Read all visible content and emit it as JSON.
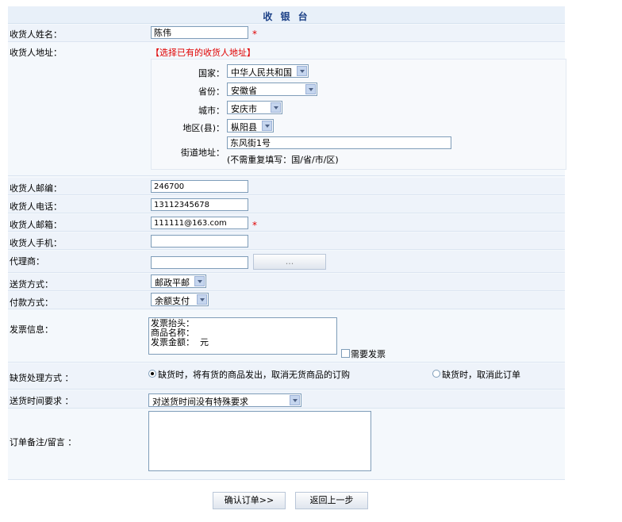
{
  "header": {
    "title": "收 银 台"
  },
  "consignee": {
    "name_label": "收货人姓名：",
    "name_value": "陈伟",
    "required_mark": "*",
    "address_label": "收货人地址：",
    "choose_existing_link": "【选择已有的收货人地址】"
  },
  "address": {
    "country_label": "国家：",
    "country_value": "中华人民共和国",
    "province_label": "省份：",
    "province_value": "安徽省",
    "city_label": "城市：",
    "city_value": "安庆市",
    "district_label": "地区(县)：",
    "district_value": "枞阳县",
    "street_label": "街道地址：",
    "street_value": "东风街1号",
    "street_hint": "(不需重复填写：国/省/市/区)"
  },
  "contact": {
    "zip_label": "收货人邮编：",
    "zip_value": "246700",
    "phone_label": "收货人电话：",
    "phone_value": "13112345678",
    "email_label": "收货人邮箱：",
    "email_value": "111111@163.com",
    "mobile_label": "收货人手机：",
    "mobile_value": "",
    "agent_label": "代理商：",
    "agent_value": "",
    "agent_button": "..."
  },
  "shipping": {
    "method_label": "送货方式：",
    "method_value": "邮政平邮",
    "payment_label": "付款方式：",
    "payment_value": "余额支付"
  },
  "invoice": {
    "label": "发票信息：",
    "lines": [
      "发票抬头：",
      "商品名称：",
      "发票金额：  元"
    ],
    "need_invoice_label": "需要发票"
  },
  "stockout": {
    "label": "缺货处理方式 ：",
    "option1": "缺货时，将有货的商品发出，取消无货商品的订购",
    "option2": "缺货时，取消此订单"
  },
  "delivery_time": {
    "label": "送货时间要求 ：",
    "value": "对送货时间没有特殊要求"
  },
  "remark": {
    "label": "订单备注/留言 ：",
    "value": ""
  },
  "actions": {
    "confirm": "确认订单>>",
    "back": "返回上一步"
  }
}
